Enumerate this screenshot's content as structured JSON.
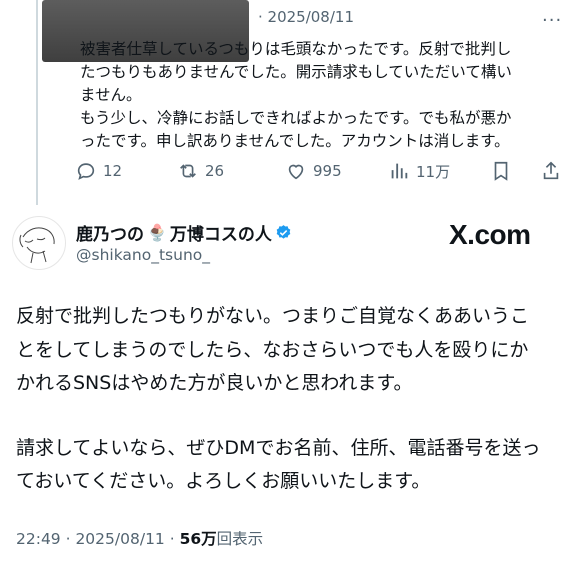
{
  "reply_tweet": {
    "date": "· 2025/08/11",
    "paragraphs": [
      "被害者仕草しているつもりは毛頭なかったです。反射で批判し",
      "たつもりもありませんでした。開示請求もしていただいて構い",
      "ません。",
      "もう少し、冷静にお話しできればよかったです。でも私が悪か",
      "ったです。申し訳ありませんでした。アカウントは消します。"
    ],
    "actions": {
      "reply_count": "12",
      "repost_count": "26",
      "like_count": "995",
      "views_count": "11万"
    }
  },
  "main_tweet": {
    "author_name": "鹿乃つの",
    "author_name_suffix": "万博コスの人",
    "author_emoji": "🍨",
    "handle": "@shikano_tsuno_",
    "watermark": "X.com",
    "lines_p1": [
      "反射で批判したつもりがない。つまりご自覚なくああいうこ",
      "とをしてしまうのでしたら、なおさらいつでも人を殴りにか",
      "かれるSNSはやめた方が良いかと思われます。"
    ],
    "lines_p2": [
      "請求してよいなら、ぜひDMでお名前、住所、電話番号を送っ",
      "ておいてください。よろしくお願いいたします。"
    ],
    "time": "22:49 · 2025/08/11 · ",
    "views_number": "56万",
    "views_label": "回表示"
  },
  "icons": [
    "more-icon",
    "reply-icon",
    "repost-icon",
    "like-icon",
    "views-icon",
    "bookmark-icon",
    "share-icon",
    "verified-icon"
  ],
  "colors": {
    "muted": "#536471",
    "verified_blue": "#1d9bf0",
    "text": "#0f1419"
  }
}
